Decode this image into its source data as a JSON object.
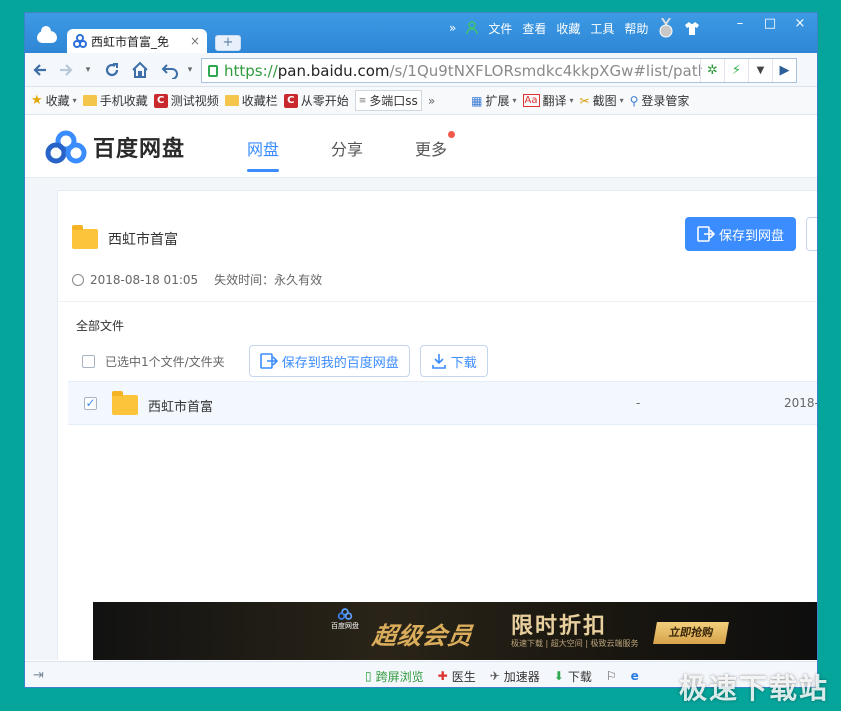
{
  "browser": {
    "tab_title": "西虹市首富_免",
    "tab_close": "×",
    "new_tab": "+",
    "menu": {
      "more": "»",
      "file": "文件",
      "view": "查看",
      "favorites": "收藏",
      "tools": "工具",
      "help": "帮助"
    },
    "window_buttons": {
      "minimize": "–",
      "maximize": "□",
      "close": "×"
    }
  },
  "address_bar": {
    "protocol": "https://",
    "host": "pan.baidu.com",
    "path": "/s/1Qu9tNXFLORsmdkc4kkpXGw#list/path="
  },
  "bookmarks": [
    {
      "label": "收藏",
      "icon": "star-icon"
    },
    {
      "label": "手机收藏",
      "icon": "folder-icon"
    },
    {
      "label": "测试视频",
      "icon": "c-icon"
    },
    {
      "label": "收藏栏",
      "icon": "folder-icon"
    },
    {
      "label": "从零开始",
      "icon": "c-icon"
    },
    {
      "label": "多端口ss",
      "icon": "page-icon"
    }
  ],
  "bookmark_overflow": "»",
  "extensions": [
    {
      "label": "扩展",
      "icon": "grid-icon"
    },
    {
      "label": "翻译",
      "icon": "translate-icon"
    },
    {
      "label": "截图",
      "icon": "screenshot-icon"
    },
    {
      "label": "登录管家",
      "icon": "key-icon"
    }
  ],
  "site": {
    "brand": "百度网盘",
    "nav": [
      "网盘",
      "分享",
      "更多"
    ]
  },
  "share": {
    "title": "西虹市首富",
    "save_button": "保存到网盘",
    "date": "2018-08-18 01:05",
    "expiry": "失效时间：永久有效",
    "breadcrumb": "全部文件",
    "selected_label": "已选中1个文件/文件夹",
    "save_to_my": "保存到我的百度网盘",
    "download": "下载"
  },
  "files": [
    {
      "name": "西虹市首富",
      "size": "-",
      "date": "2018-"
    }
  ],
  "banner": {
    "brand": "百度网盘",
    "vip": "超级会员",
    "discount": "限时折扣",
    "subtitle": "极速下载 | 超大空间 | 极致云端服务",
    "cta": "立即抢购"
  },
  "statusbar": {
    "items": [
      "跨屏浏览",
      "医生",
      "加速器",
      "下载"
    ]
  },
  "watermark": "极速下载站",
  "colors": {
    "accent": "#3b8cff",
    "titlebar": "#2f86d6",
    "background": "#06a59c"
  }
}
